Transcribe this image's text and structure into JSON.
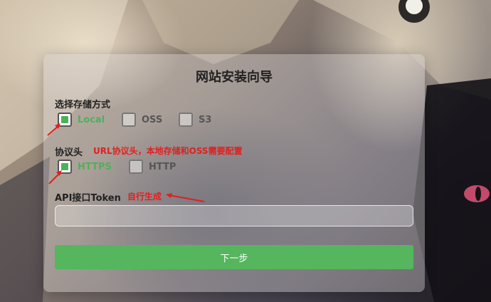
{
  "wizard": {
    "title": "网站安装向导",
    "storage": {
      "label": "选择存储方式",
      "options": [
        {
          "label": "Local",
          "checked": true
        },
        {
          "label": "OSS",
          "checked": false
        },
        {
          "label": "S3",
          "checked": false
        }
      ]
    },
    "protocol": {
      "label": "协议头",
      "note": "URL协议头，本地存储和OSS需要配置",
      "options": [
        {
          "label": "HTTPS",
          "checked": true
        },
        {
          "label": "HTTP",
          "checked": false
        }
      ]
    },
    "token": {
      "label": "API接口Token",
      "note": "自行生成",
      "value": "",
      "placeholder": ""
    },
    "next_button": "下一步"
  },
  "colors": {
    "accent_green": "#55b65d",
    "annotation_red": "#e02020"
  }
}
